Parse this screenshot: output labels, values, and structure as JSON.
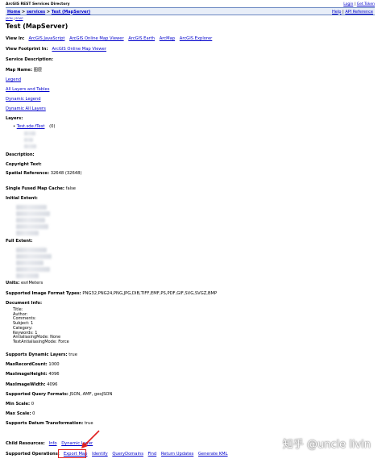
{
  "header": {
    "title": "ArcGIS REST Services Directory",
    "login": "Login",
    "get_token": "Get Token",
    "separator": "|"
  },
  "breadcrumb": {
    "home": "Home",
    "sep1": ">",
    "services": "services",
    "sep2": ">",
    "current": "Test (MapServer)"
  },
  "help": {
    "help": "Help",
    "sep": "|",
    "api": "API Reference"
  },
  "small_links": {
    "json": "JSON",
    "sep": "|",
    "soap": "SOAP"
  },
  "page_title": "Test (MapServer)",
  "view_in": {
    "label": "View In:",
    "links": [
      "ArcGIS JavaScript",
      "ArcGIS Online Map Viewer",
      "ArcGIS Earth",
      "ArcMap",
      "ArcGIS Explorer"
    ]
  },
  "view_footprint": {
    "label": "View Footprint In:",
    "link": "ArcGIS Online Map Viewer"
  },
  "service_description": {
    "label": "Service Description:"
  },
  "map_name": {
    "label": "Map Name:",
    "value": "图层"
  },
  "links": {
    "legend": "Legend",
    "all_layers": "All Layers and Tables",
    "dynamic_legend": "Dynamic Legend",
    "dynamic_all_layers": "Dynamic All Layers"
  },
  "layers": {
    "label": "Layers:",
    "item_link": "Test.sde.fTest",
    "item_suffix": "(0)"
  },
  "description": {
    "label": "Description:"
  },
  "copyright": {
    "label": "Copyright Text:"
  },
  "spatial_reference": {
    "label": "Spatial Reference:",
    "value": "32648  (32648)"
  },
  "single_fused": {
    "label": "Single Fused Map Cache:",
    "value": "false"
  },
  "initial_extent": {
    "label": "Initial Extent:"
  },
  "full_extent": {
    "label": "Full Extent:"
  },
  "units": {
    "label": "Units:",
    "value": "esriMeters"
  },
  "image_formats": {
    "label": "Supported Image Format Types:",
    "value": "PNG32,PNG24,PNG,JPG,DIB,TIFF,EMF,PS,PDF,GIF,SVG,SVGZ,BMP"
  },
  "document_info": {
    "label": "Document Info:",
    "lines": "Title:\nAuthor:\nComments:\nSubject: 1\nCategory:\nKeywords: 1\nAntialiasingMode: None\nTextAntialiasingMode: Force"
  },
  "dynamic_layers": {
    "label": "Supports Dynamic Layers:",
    "value": "true"
  },
  "max_record": {
    "label": "MaxRecordCount:",
    "value": "1000"
  },
  "max_height": {
    "label": "MaxImageHeight:",
    "value": "4096"
  },
  "max_width": {
    "label": "MaxImageWidth:",
    "value": "4096"
  },
  "query_formats": {
    "label": "Supported Query Formats:",
    "value": "JSON, AMF, geoJSON"
  },
  "min_scale": {
    "label": "Min Scale:",
    "value": "0"
  },
  "max_scale": {
    "label": "Max Scale:",
    "value": "0"
  },
  "datum": {
    "label": "Supports Datum Transformation:",
    "value": "true"
  },
  "child_resources": {
    "label": "Child Resources:",
    "links": [
      "Info",
      "Dynamic Layer"
    ]
  },
  "operations": {
    "label": "Supported Operations:",
    "links": [
      "Export Map",
      "Identify",
      "QueryDomains",
      "Find",
      "Return Updates",
      "Generate KML"
    ]
  },
  "watermark": "知乎 @uncle livin",
  "highlight_color": "#e02020"
}
